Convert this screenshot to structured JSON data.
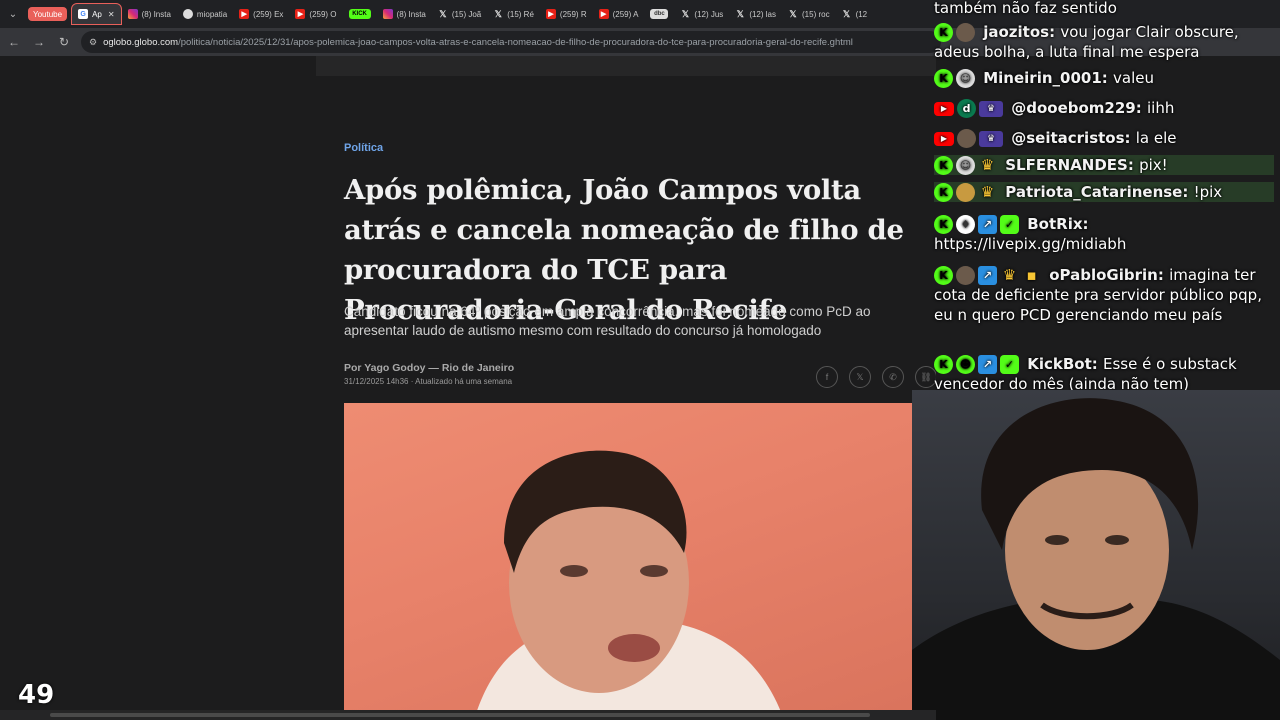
{
  "browser": {
    "tabs": [
      {
        "label": "Youtube",
        "kind": "group"
      },
      {
        "label": "Ap",
        "kind": "active",
        "icon": "G"
      },
      {
        "label": "(8) Insta",
        "icon": "ig"
      },
      {
        "label": "miopatia",
        "icon": "chr"
      },
      {
        "label": "(259) Ex",
        "icon": "yt"
      },
      {
        "label": "(259) O",
        "icon": "yt"
      },
      {
        "label": "KICK",
        "icon": "kick"
      },
      {
        "label": "(8) Insta",
        "icon": "ig"
      },
      {
        "label": "(15) Joã",
        "icon": "x"
      },
      {
        "label": "(15) Ré",
        "icon": "x"
      },
      {
        "label": "(259) R",
        "icon": "yt"
      },
      {
        "label": "(259) A",
        "icon": "yt"
      },
      {
        "label": "dbc",
        "icon": "dbc"
      },
      {
        "label": "(12) Jus",
        "icon": "x"
      },
      {
        "label": "(12) las",
        "icon": "x"
      },
      {
        "label": "(15) roc",
        "icon": "x"
      },
      {
        "label": "(12",
        "icon": "x"
      }
    ],
    "url_domain": "oglobo.globo.com",
    "url_path": "/politica/noticia/2025/12/31/apos-polemica-joao-campos-volta-atras-e-cancela-nomeacao-de-filho-de-procuradora-do-tce-para-procuradoria-geral-do-recife.ghtml"
  },
  "article": {
    "section": "Política",
    "headline": "Após polêmica, João Campos volta atrás e cancela nomeação de filho de procuradora do TCE para Procuradoria-Geral do Recife",
    "subhead": "Candidato ficou na 64º posição em ampla concorrência, mas foi nomeado como PcD ao apresentar laudo de autismo mesmo com resultado do concurso já homologado",
    "byline": "Por Yago Godoy — Rio de Janeiro",
    "dateline": "31/12/2025 14h36 · Atualizado há uma semana"
  },
  "chat": {
    "top_text": "também não faz sentido",
    "messages": [
      {
        "user": "jaozitos:",
        "text": "vou jogar Clair obscure, adeus bolha, a luta final me espera"
      },
      {
        "user": "Mineirin_0001:",
        "text": "valeu"
      },
      {
        "user": "@dooebom229:",
        "text": "iihh",
        "avatar_letter": "d"
      },
      {
        "user": "@seitacristos:",
        "text": "la ele"
      },
      {
        "user": "SLFERNANDES:",
        "text": "pix!"
      },
      {
        "user": "Patriota_Catarinense:",
        "text": "!pix"
      },
      {
        "user": "BotRix:",
        "text": "https://livepix.gg/midiabh"
      },
      {
        "user": "oPabloGibrin:",
        "text": "imagina ter cota de deficiente pra servidor público pqp, eu n quero PCD gerenciando meu país"
      },
      {
        "user": "KickBot:",
        "text": "Esse é o substack vencedor do mês (ainda não tem)"
      }
    ]
  },
  "overlay": {
    "counter": "49"
  },
  "colors": {
    "kick": "#53fc18",
    "section": "#6fa4e8",
    "youtube": "#e62117"
  }
}
